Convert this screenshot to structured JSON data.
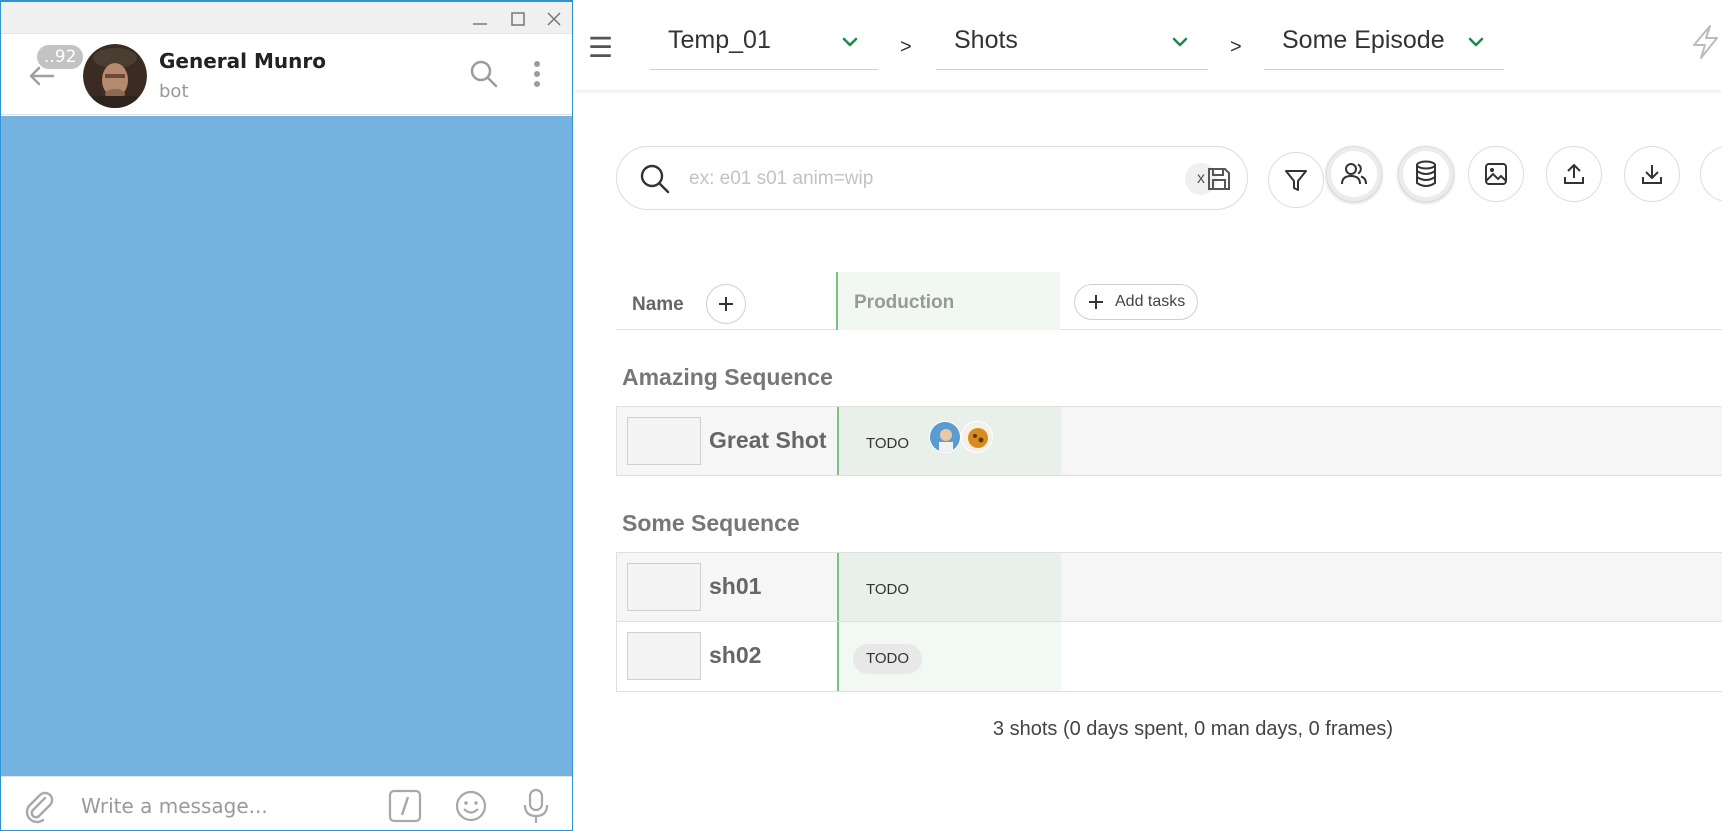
{
  "telegram": {
    "unread_badge": "..92",
    "contact_name": "General Munro",
    "contact_status": "bot",
    "message_placeholder": "Write a message...",
    "chat_background": "#74b3df"
  },
  "app": {
    "breadcrumb": {
      "production": "Temp_01",
      "section": "Shots",
      "episode": "Some Episode",
      "separator": ">"
    },
    "search": {
      "placeholder": "ex: e01 s01 anim=wip",
      "clear_label": "x"
    },
    "table": {
      "name_header": "Name",
      "task_column": "Production",
      "add_tasks_label": "Add tasks"
    },
    "sequences": [
      {
        "name": "Amazing Sequence",
        "shots": [
          {
            "name": "Great Shot",
            "status": "TODO",
            "assignees": [
              "avatar-person",
              "avatar-animal"
            ]
          }
        ]
      },
      {
        "name": "Some Sequence",
        "shots": [
          {
            "name": "sh01",
            "status": "TODO",
            "assignees": []
          },
          {
            "name": "sh02",
            "status": "TODO",
            "assignees": []
          }
        ]
      }
    ],
    "stats": "3 shots (0 days spent, 0 man days, 0 frames)",
    "accent_color": "#1f8a4c",
    "task_column_color": "#7fbf7f"
  }
}
